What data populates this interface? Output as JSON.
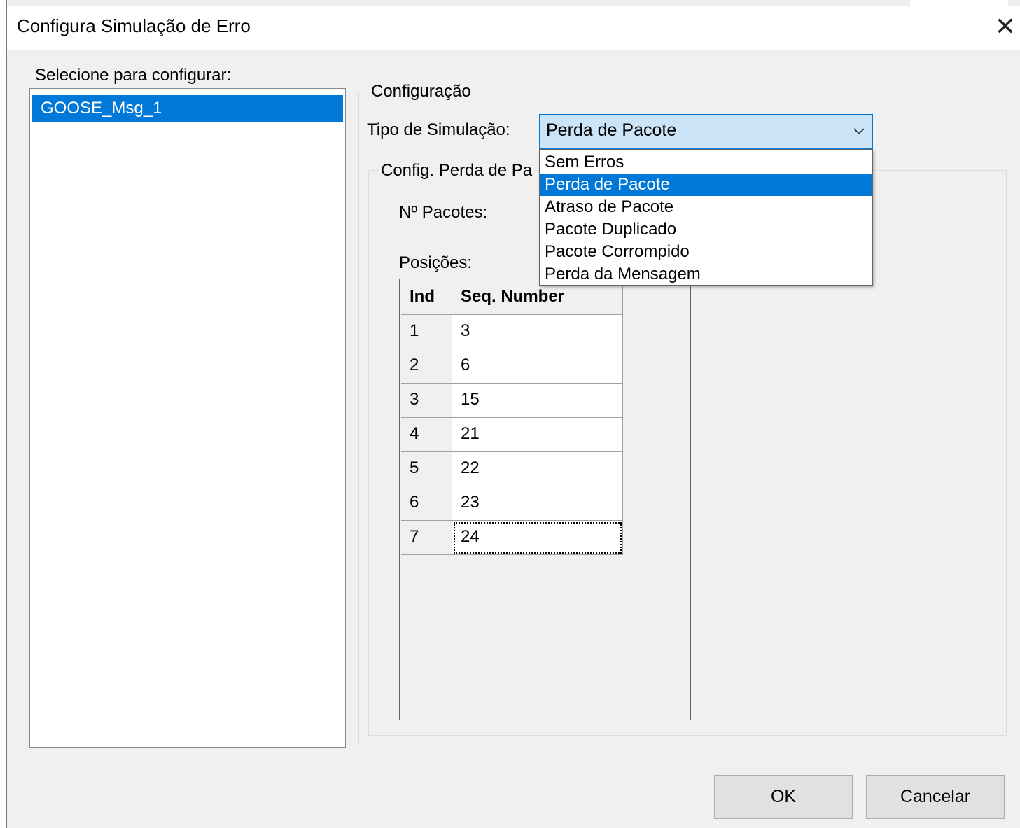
{
  "window": {
    "title": "Configura Simulação de Erro",
    "close_symbol": "✕"
  },
  "left_panel": {
    "label": "Selecione para configurar:",
    "items": [
      "GOOSE_Msg_1"
    ]
  },
  "config_group": {
    "title": "Configuração",
    "sim_type_label": "Tipo de Simulação:",
    "sim_type_value": "Perda de Pacote",
    "options": [
      "Sem Erros",
      "Perda de Pacote",
      "Atraso de Pacote",
      "Pacote Duplicado",
      "Pacote Corrompido",
      "Perda da Mensagem"
    ],
    "selected_option": "Perda de Pacote"
  },
  "loss_group": {
    "title_visible": "Config. Perda de Pa",
    "num_packets_label": "Nº Pacotes:",
    "positions_label": "Posições:"
  },
  "grid": {
    "columns": [
      "Ind",
      "Seq. Number"
    ],
    "rows": [
      [
        "1",
        "3"
      ],
      [
        "2",
        "6"
      ],
      [
        "3",
        "15"
      ],
      [
        "4",
        "21"
      ],
      [
        "5",
        "22"
      ],
      [
        "6",
        "23"
      ],
      [
        "7",
        "24"
      ]
    ]
  },
  "buttons": {
    "ok": "OK",
    "cancel": "Cancelar"
  },
  "colors": {
    "selection": "#0078d7",
    "window_bg": "#f0f0f0",
    "combo_focus_bg": "#cce4f7"
  }
}
